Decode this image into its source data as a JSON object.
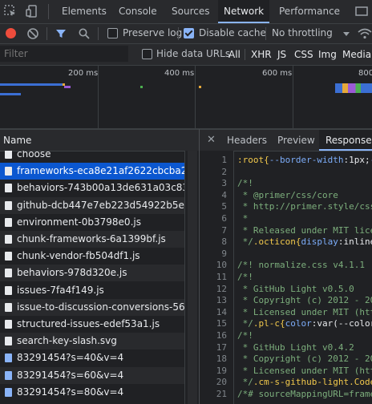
{
  "devtools": {
    "tabs": [
      "Elements",
      "Console",
      "Sources",
      "Network",
      "Performance"
    ],
    "active_tab": "Network"
  },
  "toolbar": {
    "preserve_log": "Preserve log",
    "disable_cache": "Disable cache",
    "throttling": "No throttling",
    "preserve_log_checked": false,
    "disable_cache_checked": true
  },
  "filterbar": {
    "placeholder": "Filter",
    "hide_data_urls": "Hide data URLs",
    "filters": [
      "All",
      "XHR",
      "JS",
      "CSS",
      "Img",
      "Media"
    ]
  },
  "overview": {
    "ticks": [
      "200 ms",
      "400 ms",
      "600 ms",
      "800"
    ]
  },
  "name_panel": {
    "header": "Name",
    "rows": [
      {
        "name": "choose",
        "type": "doc"
      },
      {
        "name": "frameworks-eca8e21af2622cbcba2c93c0",
        "type": "doc",
        "selected": true
      },
      {
        "name": "behaviors-743b00a13de631a03c8322d9",
        "type": "doc"
      },
      {
        "name": "github-dcb447e7eb223d54922b5e8042",
        "type": "doc"
      },
      {
        "name": "environment-0b3798e0.js",
        "type": "doc"
      },
      {
        "name": "chunk-frameworks-6a1399bf.js",
        "type": "doc"
      },
      {
        "name": "chunk-vendor-fb504df1.js",
        "type": "doc"
      },
      {
        "name": "behaviors-978d320e.js",
        "type": "doc"
      },
      {
        "name": "issues-7fa4f149.js",
        "type": "doc"
      },
      {
        "name": "issue-to-discussion-conversions-56ea5b",
        "type": "doc"
      },
      {
        "name": "structured-issues-edef53a1.js",
        "type": "doc"
      },
      {
        "name": "search-key-slash.svg",
        "type": "doc"
      },
      {
        "name": "83291454?s=40&v=4",
        "type": "img"
      },
      {
        "name": "83291454?s=60&v=4",
        "type": "img"
      },
      {
        "name": "83291454?s=80&v=4",
        "type": "img"
      }
    ]
  },
  "response_panel": {
    "tabs": [
      "Headers",
      "Preview",
      "Response",
      "I"
    ],
    "active_tab": "Response",
    "line_numbers": [
      "1",
      "2",
      "3",
      "4",
      "5",
      "6",
      "7",
      "8",
      "9",
      "10",
      "11",
      "12",
      "13",
      "14",
      "15",
      "16",
      "17",
      "18",
      "19",
      "20",
      "21"
    ],
    "lines": [
      [
        [
          ":root{",
          "sel"
        ],
        [
          "--border-width",
          "prop"
        ],
        [
          ":1px;",
          "val"
        ],
        [
          "--",
          "prop"
        ]
      ],
      [
        [
          "",
          "c"
        ]
      ],
      [
        [
          "/*!",
          "c"
        ]
      ],
      [
        [
          " * @primer/css/core",
          "c"
        ]
      ],
      [
        [
          " * http://primer.style/css",
          "c"
        ]
      ],
      [
        [
          " *",
          "c"
        ]
      ],
      [
        [
          " * Released under MIT lice",
          "c"
        ]
      ],
      [
        [
          " */",
          "c"
        ],
        [
          ".octicon{",
          "sel"
        ],
        [
          "display",
          "prop"
        ],
        [
          ":inline",
          "val"
        ]
      ],
      [
        [
          "",
          "c"
        ]
      ],
      [
        [
          "/*! normalize.css v4.1.1 |",
          "c"
        ]
      ],
      [
        [
          "/*!",
          "c"
        ]
      ],
      [
        [
          " * GitHub Light v0.5.0",
          "c"
        ]
      ],
      [
        [
          " * Copyright (c) 2012 - 20",
          "c"
        ]
      ],
      [
        [
          " * Licensed under MIT (htt",
          "c"
        ]
      ],
      [
        [
          " */",
          "c"
        ],
        [
          ".pl-c{",
          "sel"
        ],
        [
          "color",
          "prop"
        ],
        [
          ":var(--color-",
          "val"
        ]
      ],
      [
        [
          "/*!",
          "c"
        ]
      ],
      [
        [
          " * GitHub Light v0.4.2",
          "c"
        ]
      ],
      [
        [
          " * Copyright (c) 2012 - 20",
          "c"
        ]
      ],
      [
        [
          " * Licensed under MIT (htt",
          "c"
        ]
      ],
      [
        [
          " */",
          "c"
        ],
        [
          ".cm-s-github-light.Code",
          "sel"
        ]
      ],
      [
        [
          "/*# sourceMappingURL=frame",
          "c"
        ]
      ]
    ]
  }
}
